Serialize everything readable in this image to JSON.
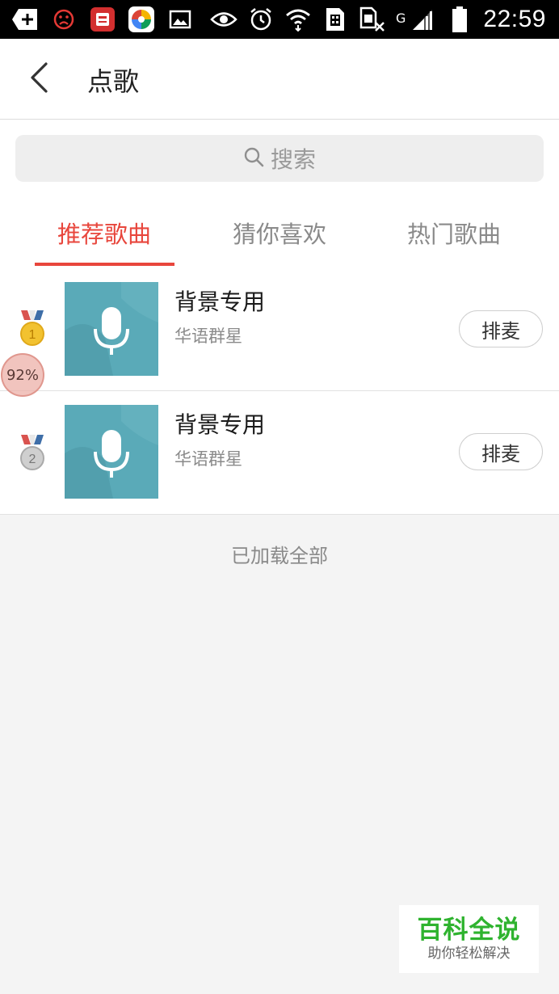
{
  "status_bar": {
    "time": "22:59",
    "network": "G",
    "left_icons": [
      "add-box-icon",
      "sad-face-icon",
      "news-app-icon",
      "colorful-app-icon",
      "gallery-icon"
    ],
    "right_icons": [
      "eye-icon",
      "alarm-icon",
      "wifi-icon",
      "sim-icon",
      "data-off-icon",
      "signal-icon",
      "battery-icon"
    ]
  },
  "header": {
    "title": "点歌",
    "back_icon": "chevron-left-icon"
  },
  "search": {
    "placeholder": "搜索",
    "icon": "search-icon"
  },
  "tabs": [
    {
      "label": "推荐歌曲",
      "active": true
    },
    {
      "label": "猜你喜欢",
      "active": false
    },
    {
      "label": "热门歌曲",
      "active": false
    }
  ],
  "songs": [
    {
      "rank": "1",
      "title": "背景专用",
      "artist": "华语群星",
      "button": "排麦",
      "medal": "gold"
    },
    {
      "rank": "2",
      "title": "背景专用",
      "artist": "华语群星",
      "button": "排麦",
      "medal": "silver"
    }
  ],
  "list_footer": "已加载全部",
  "floating_bubble": {
    "text": "92%"
  },
  "watermark": {
    "main": "百科全说",
    "sub": "助你轻松解决"
  },
  "colors": {
    "accent": "#e8463c",
    "cover": "#5aaab8",
    "watermark_green": "#2fb32f"
  }
}
